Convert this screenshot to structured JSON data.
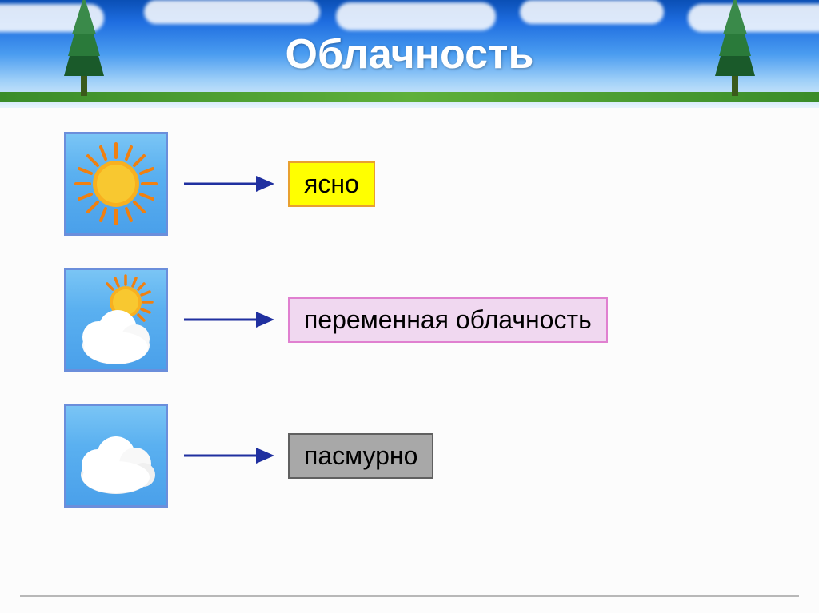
{
  "title": "Облачность",
  "rows": [
    {
      "icon": "sun",
      "label": "ясно",
      "label_style": "yellow"
    },
    {
      "icon": "partly-cloudy",
      "label": "переменная облачность",
      "label_style": "pink"
    },
    {
      "icon": "cloudy",
      "label": "пасмурно",
      "label_style": "gray"
    }
  ],
  "colors": {
    "sky_top": "#0a4fb5",
    "arrow": "#2030a0",
    "accent_yellow": "#ffff00",
    "accent_pink": "#f0d8f0",
    "accent_gray": "#a8a8a8"
  }
}
